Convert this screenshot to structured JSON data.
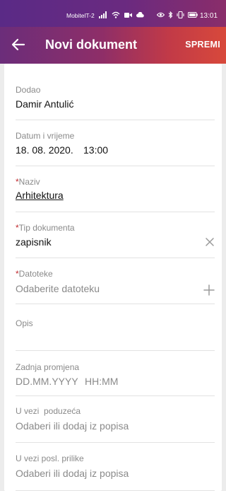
{
  "status_bar": {
    "carrier": "MobitelT-2",
    "time": "13:01",
    "icons": [
      "signal-icon",
      "wifi-icon",
      "video-icon",
      "cloud-icon",
      "eye-icon",
      "bluetooth-icon",
      "vibrate-icon",
      "battery-icon"
    ]
  },
  "header": {
    "title": "Novi dokument",
    "save_label": "SPREMI",
    "back_icon": "arrow-left-icon"
  },
  "form": {
    "added_by": {
      "label": "Dodao",
      "value": "Damir Antulić"
    },
    "datetime": {
      "label": "Datum i vrijeme",
      "date": "18. 08. 2020.",
      "time": "13:00"
    },
    "name": {
      "required_mark": "*",
      "label": "Naziv",
      "value": "Arhitektura"
    },
    "doc_type": {
      "required_mark": "*",
      "label": "Tip dokumenta",
      "value": "zapisnik",
      "action_icon": "clear-icon"
    },
    "files": {
      "required_mark": "*",
      "label": "Datoteke",
      "placeholder": "Odaberite datoteku",
      "action_icon": "plus-icon"
    },
    "description": {
      "label": "Opis",
      "value": ""
    },
    "last_change": {
      "label": "Zadnja promjena",
      "date_placeholder": "DD.MM.YYYY",
      "time_placeholder": "HH:MM"
    },
    "company": {
      "label": "U vezi  poduzeća",
      "placeholder": "Odaberi ili dodaj iz popisa"
    },
    "opportunity": {
      "label": "U vezi posl. prilike",
      "placeholder": "Odaberi ili dodaj iz popisa"
    }
  }
}
